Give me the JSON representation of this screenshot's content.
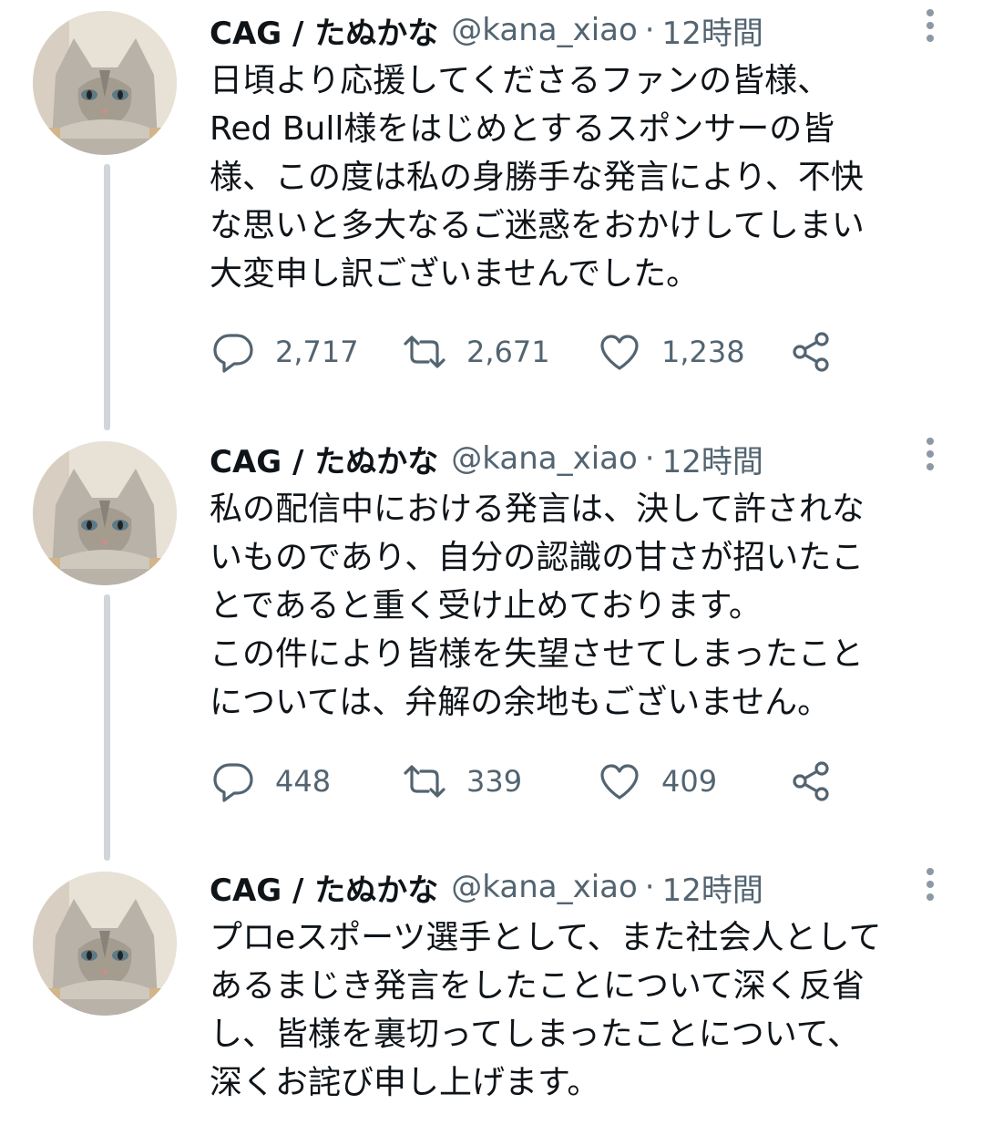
{
  "tweets": [
    {
      "author_name": "CAG / たぬかな",
      "handle": "@kana_xiao",
      "separator": "·",
      "time": "12時間",
      "text": "日頃より応援してくださるファンの皆様、\nRed Bull様をはじめとするスポンサーの皆\n様、この度は私の身勝手な発言により、不快\nな思いと多大なるご迷惑をおかけしてしまい\n大変申し訳ございませんでした。",
      "replies": "2,717",
      "retweets": "2,671",
      "likes": "1,238"
    },
    {
      "author_name": "CAG / たぬかな",
      "handle": "@kana_xiao",
      "separator": "·",
      "time": "12時間",
      "text": "私の配信中における発言は、決して許されな\nいものであり、自分の認識の甘さが招いたこ\nとであると重く受け止めております。\nこの件により皆様を失望させてしまったこと\nについては、弁解の余地もございません。",
      "replies": "448",
      "retweets": "339",
      "likes": "409"
    },
    {
      "author_name": "CAG / たぬかな",
      "handle": "@kana_xiao",
      "separator": "·",
      "time": "12時間",
      "text": "プロeスポーツ選手として、また社会人として\nあるまじき発言をしたことについて深く反省\nし、皆様を裏切ってしまったことについて、\n深くお詫び申し上げます。"
    }
  ],
  "icons": {
    "reply": "reply-icon",
    "retweet": "retweet-icon",
    "like": "like-icon",
    "share": "share-icon",
    "more": "more-vertical-icon"
  },
  "colors": {
    "text": "#0f1419",
    "secondary": "#536471",
    "thread_line": "#d0d6db"
  }
}
